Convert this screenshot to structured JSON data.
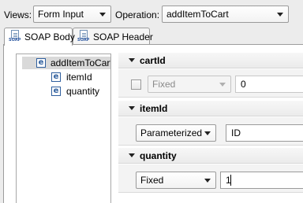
{
  "toolbar": {
    "views_label": "Views:",
    "views_value": "Form Input",
    "operation_label": "Operation:",
    "operation_value": "addItemToCart"
  },
  "tabs": [
    {
      "label": "SOAP Body",
      "icon": "soap-document-icon",
      "active": true
    },
    {
      "label": "SOAP Header",
      "icon": "soap-document-icon",
      "active": false
    }
  ],
  "icon_text": {
    "soap": "SOAP"
  },
  "tree": {
    "root": {
      "icon": "e",
      "label": "addItemToCart"
    },
    "children": [
      {
        "icon": "e",
        "label": "itemId"
      },
      {
        "icon": "e",
        "label": "quantity"
      }
    ]
  },
  "form": {
    "sections": [
      {
        "name": "cartId",
        "mode": "Fixed",
        "value": "0",
        "checkbox": true,
        "enabled": false
      },
      {
        "name": "itemId",
        "mode": "Parameterized",
        "value": "ID",
        "checkbox": false,
        "enabled": true
      },
      {
        "name": "quantity",
        "mode": "Fixed",
        "value": "1",
        "checkbox": false,
        "enabled": true
      }
    ]
  },
  "colors": {
    "background": "#ececec",
    "icon_blue": "#2f5f9e",
    "selection": "#d9d9d9"
  }
}
